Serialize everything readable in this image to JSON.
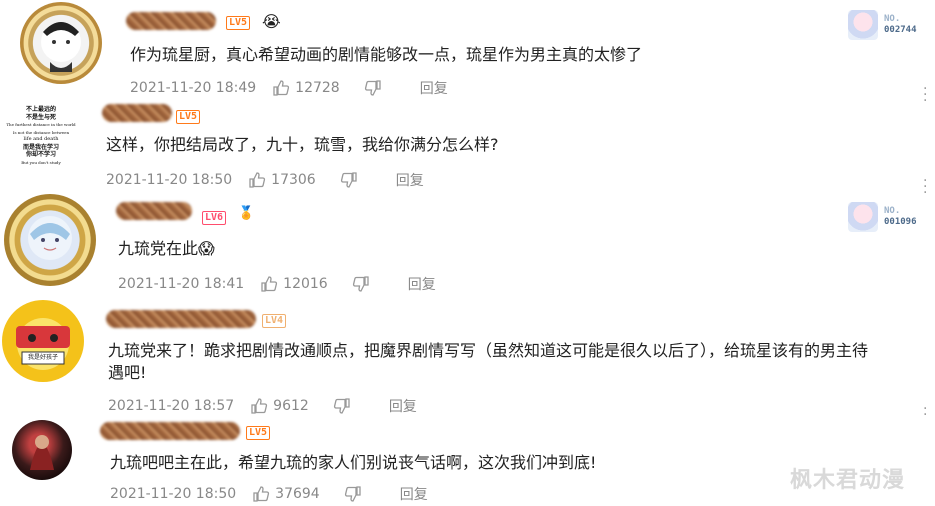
{
  "comments": [
    {
      "text": "作为琉星厨，真心希望动画的剧情能够改一点，琉星作为男主真的太惨了",
      "time": "2021-11-20 18:49",
      "likes": "12728",
      "level": "LV5",
      "reply": "回复",
      "badge": {
        "label": "NO.",
        "number": "002744"
      },
      "emoji": "😭"
    },
    {
      "text": "这样，你把结局改了，九十，琉雪，我给你满分怎么样?",
      "time": "2021-11-20 18:50",
      "likes": "17306",
      "level": "LV5",
      "reply": "回复",
      "avatar_text": [
        "不上最远的",
        "不是生与死",
        "The furthest distance in the world",
        "Is not the distance between",
        "life and death",
        "而是我在学习",
        "你却不学习",
        "But you don't study"
      ]
    },
    {
      "text": "九琉党在此😱",
      "time": "2021-11-20 18:41",
      "likes": "12016",
      "level": "LV6",
      "reply": "回复",
      "badge": {
        "label": "NO.",
        "number": "001096"
      },
      "emoji": "🏅"
    },
    {
      "text_line1": "九琉党来了！跪求把剧情改通顺点，把魔界剧情写写（虽然知道这可能是很久以后了），给琉星该有的男主待",
      "text_line2": "遇吧!",
      "time": "2021-11-20 18:57",
      "likes": "9612",
      "level": "LV4",
      "reply": "回复",
      "avatar_text": "我是好孩子"
    },
    {
      "text": "九琉吧吧主在此，希望九琉的家人们别说丧气话啊，这次我们冲到底!",
      "time": "2021-11-20 18:50",
      "likes": "37694",
      "level": "LV5",
      "reply": "回复"
    }
  ],
  "watermark": "枫木君动漫",
  "icons": {
    "like": "thumbs-up-icon",
    "dislike": "thumbs-down-icon",
    "more": "more-vertical-icon"
  },
  "colors": {
    "level": "#ff7a1a",
    "meta": "#888888",
    "text": "#222222"
  }
}
